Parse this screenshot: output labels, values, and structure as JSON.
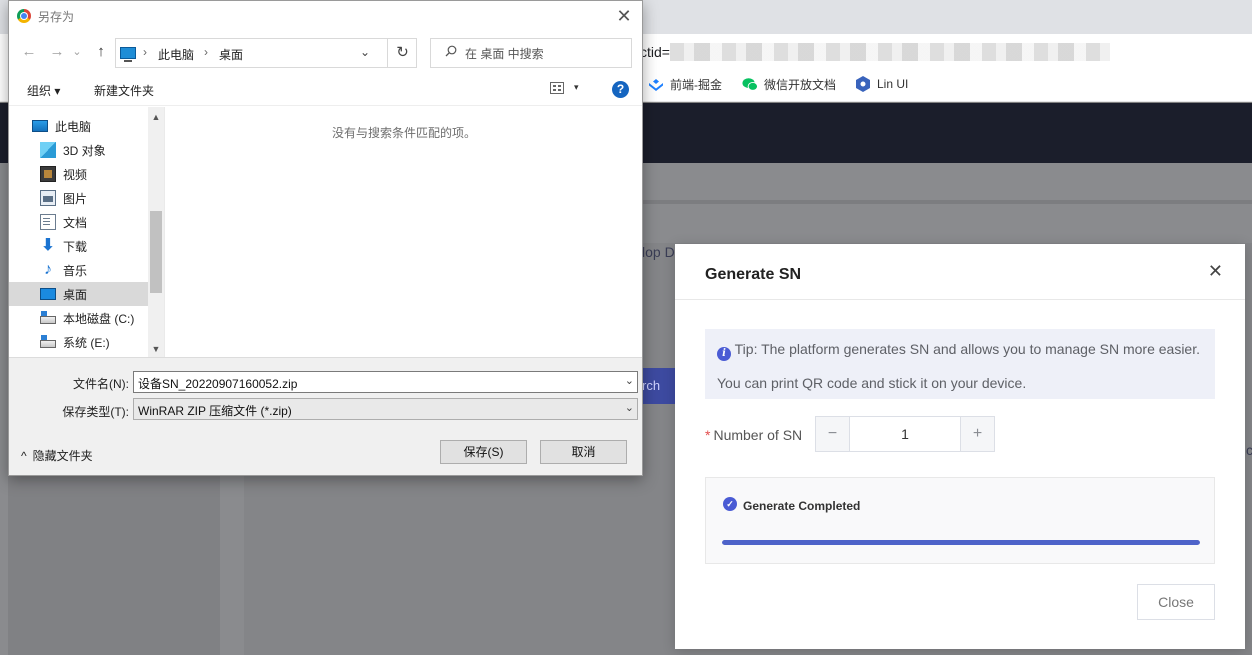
{
  "browser": {
    "address_fragment": "ctid=",
    "bookmarks": [
      {
        "label": "前端-掘金",
        "icon": "juejin-icon",
        "color": "#1e80ff"
      },
      {
        "label": "微信开放文档",
        "icon": "wechat-icon",
        "color": "#07c160"
      },
      {
        "label": "Lin UI",
        "icon": "lin-ui-icon",
        "color": "#3963bc"
      }
    ],
    "background_fragments": {
      "text1": "lop D",
      "search_btn": "rch",
      "edge_char": "c"
    }
  },
  "save_dialog": {
    "title": "另存为",
    "close_glyph": "✕",
    "nav": {
      "back": "←",
      "forward": "→",
      "dropdown": "⌄",
      "up": "↑"
    },
    "path": {
      "segments": [
        "此电脑",
        "桌面"
      ],
      "sep": "›",
      "dropdown": "⌄",
      "refresh": "↻"
    },
    "search": {
      "placeholder": "在 桌面 中搜索",
      "icon": "search-icon"
    },
    "toolbar": {
      "organize": "组织 ▾",
      "new_folder": "新建文件夹",
      "help": "?",
      "view_dd": "▾"
    },
    "tree": [
      {
        "label": "此电脑",
        "icon": "this-pc-icon",
        "level": 0,
        "selected": false
      },
      {
        "label": "3D 对象",
        "icon": "3d-objects-icon",
        "level": 1,
        "selected": false
      },
      {
        "label": "视频",
        "icon": "video-icon",
        "level": 1,
        "selected": false
      },
      {
        "label": "图片",
        "icon": "pictures-icon",
        "level": 1,
        "selected": false
      },
      {
        "label": "文档",
        "icon": "documents-icon",
        "level": 1,
        "selected": false
      },
      {
        "label": "下载",
        "icon": "download-icon",
        "level": 1,
        "selected": false
      },
      {
        "label": "音乐",
        "icon": "music-icon",
        "level": 1,
        "selected": false
      },
      {
        "label": "桌面",
        "icon": "desktop-icon",
        "level": 1,
        "selected": true
      },
      {
        "label": "本地磁盘 (C:)",
        "icon": "drive-icon",
        "level": 1,
        "selected": false
      },
      {
        "label": "系统 (E:)",
        "icon": "drive-icon",
        "level": 1,
        "selected": false
      }
    ],
    "scroll": {
      "up": "▲",
      "down": "▼"
    },
    "empty_message": "没有与搜索条件匹配的项。",
    "filename_label": "文件名(N):",
    "filename_value": "设备SN_20220907160052.zip",
    "filetype_label": "保存类型(T):",
    "filetype_value": "WinRAR ZIP 压缩文件 (*.zip)",
    "field_dd": "⌄",
    "hide_folders": "隐藏文件夹",
    "hide_folders_icon": "^",
    "save_button": "保存(S)",
    "cancel_button": "取消"
  },
  "sn_modal": {
    "title": "Generate SN",
    "close_glyph": "✕",
    "tip_icon": "i",
    "tip_line1": "Tip: The platform generates SN and allows you to manage SN more easier.",
    "tip_line2": "You can print QR code and stick it on your device.",
    "required_mark": "*",
    "number_label": "Number of SN",
    "minus": "−",
    "plus": "+",
    "number_value": "1",
    "status_icon": "✓",
    "status_text": "Generate Completed",
    "progress": 100,
    "accent_color": "#4e63c9",
    "close_button": "Close"
  }
}
